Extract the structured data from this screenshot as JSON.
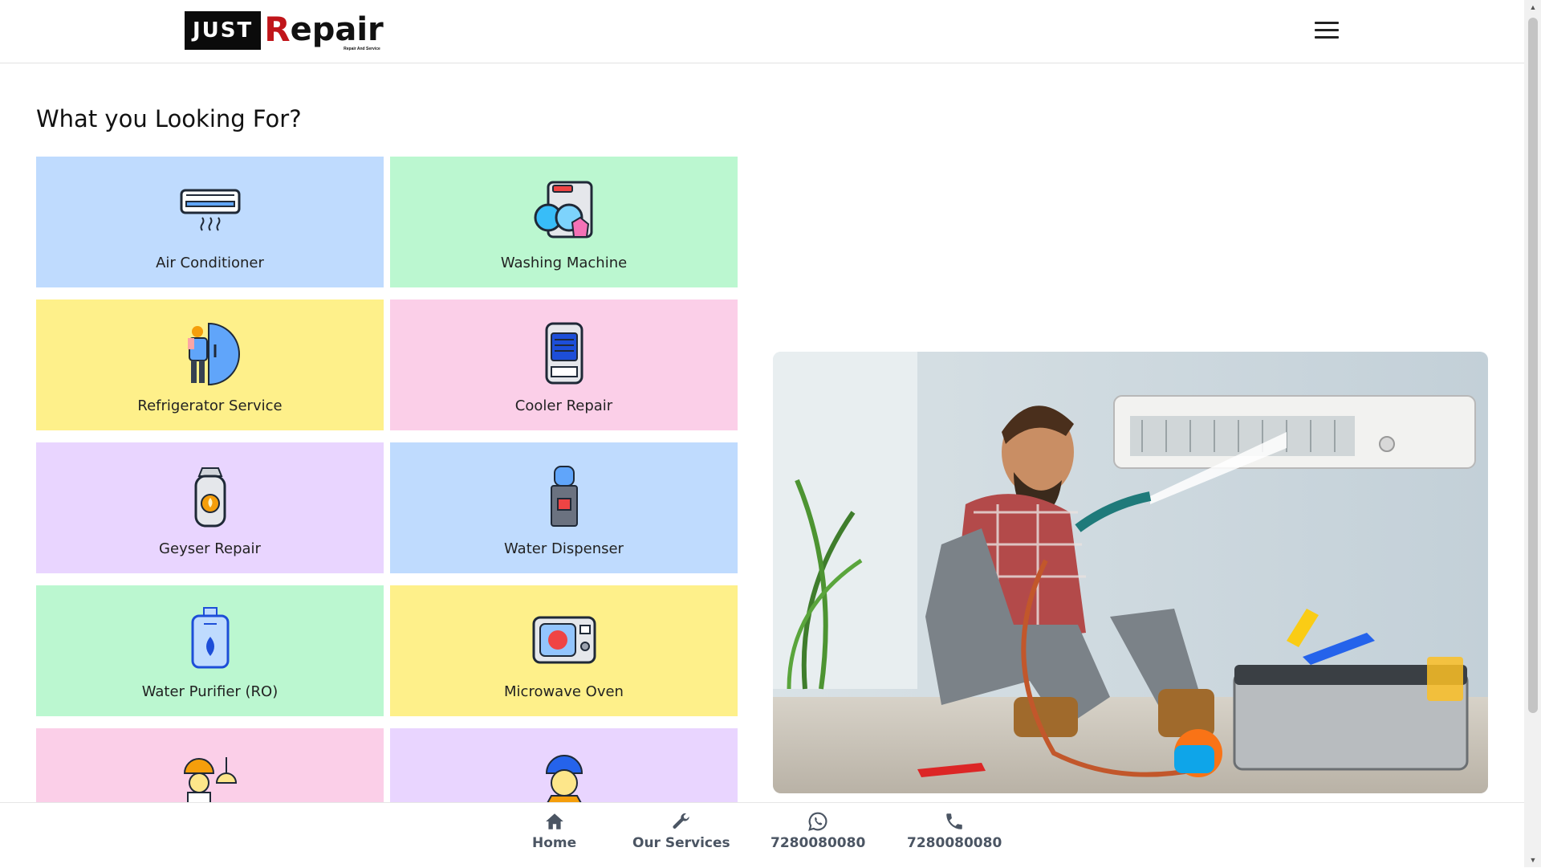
{
  "header": {
    "logo": {
      "part1": "JUST",
      "part2_r": "R",
      "part2_rest": "epair",
      "tagline": "Repair And Service"
    },
    "menu_icon": "hamburger-menu-icon"
  },
  "main": {
    "title": "What you Looking For?",
    "services": [
      {
        "label": "Air Conditioner",
        "icon": "air-conditioner-icon",
        "bg": "#bfdbfe"
      },
      {
        "label": "Washing Machine",
        "icon": "washing-machine-icon",
        "bg": "#bbf7d0"
      },
      {
        "label": "Refrigerator Service",
        "icon": "refrigerator-icon",
        "bg": "#fef08a"
      },
      {
        "label": "Cooler Repair",
        "icon": "cooler-icon",
        "bg": "#fbcfe8"
      },
      {
        "label": "Geyser Repair",
        "icon": "geyser-icon",
        "bg": "#e9d5ff"
      },
      {
        "label": "Water Dispenser",
        "icon": "water-dispenser-icon",
        "bg": "#bfdbfe"
      },
      {
        "label": "Water Purifier (RO)",
        "icon": "water-purifier-icon",
        "bg": "#bbf7d0"
      },
      {
        "label": "Microwave Oven",
        "icon": "microwave-icon",
        "bg": "#fef08a"
      },
      {
        "label": "",
        "icon": "electrician-icon",
        "bg": "#fbcfe8"
      },
      {
        "label": "",
        "icon": "plumber-icon",
        "bg": "#e9d5ff"
      }
    ]
  },
  "bottom_nav": [
    {
      "label": "Home",
      "icon": "home-icon"
    },
    {
      "label": "Our Services",
      "icon": "wrench-icon"
    },
    {
      "label": "7280080080",
      "icon": "whatsapp-icon"
    },
    {
      "label": "7280080080",
      "icon": "phone-icon"
    }
  ]
}
